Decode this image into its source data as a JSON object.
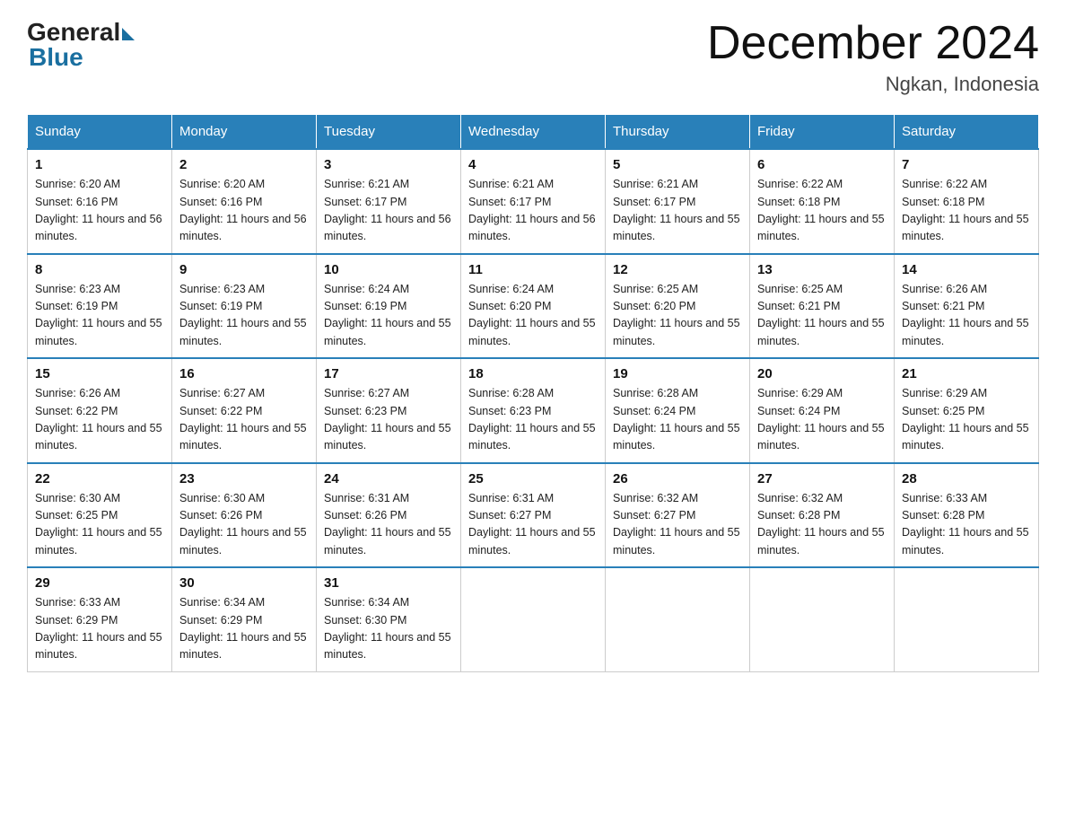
{
  "header": {
    "logo_general": "General",
    "logo_blue": "Blue",
    "title": "December 2024",
    "location": "Ngkan, Indonesia"
  },
  "days_of_week": [
    "Sunday",
    "Monday",
    "Tuesday",
    "Wednesday",
    "Thursday",
    "Friday",
    "Saturday"
  ],
  "weeks": [
    [
      {
        "day": 1,
        "sunrise": "6:20 AM",
        "sunset": "6:16 PM",
        "daylight": "11 hours and 56 minutes."
      },
      {
        "day": 2,
        "sunrise": "6:20 AM",
        "sunset": "6:16 PM",
        "daylight": "11 hours and 56 minutes."
      },
      {
        "day": 3,
        "sunrise": "6:21 AM",
        "sunset": "6:17 PM",
        "daylight": "11 hours and 56 minutes."
      },
      {
        "day": 4,
        "sunrise": "6:21 AM",
        "sunset": "6:17 PM",
        "daylight": "11 hours and 56 minutes."
      },
      {
        "day": 5,
        "sunrise": "6:21 AM",
        "sunset": "6:17 PM",
        "daylight": "11 hours and 55 minutes."
      },
      {
        "day": 6,
        "sunrise": "6:22 AM",
        "sunset": "6:18 PM",
        "daylight": "11 hours and 55 minutes."
      },
      {
        "day": 7,
        "sunrise": "6:22 AM",
        "sunset": "6:18 PM",
        "daylight": "11 hours and 55 minutes."
      }
    ],
    [
      {
        "day": 8,
        "sunrise": "6:23 AM",
        "sunset": "6:19 PM",
        "daylight": "11 hours and 55 minutes."
      },
      {
        "day": 9,
        "sunrise": "6:23 AM",
        "sunset": "6:19 PM",
        "daylight": "11 hours and 55 minutes."
      },
      {
        "day": 10,
        "sunrise": "6:24 AM",
        "sunset": "6:19 PM",
        "daylight": "11 hours and 55 minutes."
      },
      {
        "day": 11,
        "sunrise": "6:24 AM",
        "sunset": "6:20 PM",
        "daylight": "11 hours and 55 minutes."
      },
      {
        "day": 12,
        "sunrise": "6:25 AM",
        "sunset": "6:20 PM",
        "daylight": "11 hours and 55 minutes."
      },
      {
        "day": 13,
        "sunrise": "6:25 AM",
        "sunset": "6:21 PM",
        "daylight": "11 hours and 55 minutes."
      },
      {
        "day": 14,
        "sunrise": "6:26 AM",
        "sunset": "6:21 PM",
        "daylight": "11 hours and 55 minutes."
      }
    ],
    [
      {
        "day": 15,
        "sunrise": "6:26 AM",
        "sunset": "6:22 PM",
        "daylight": "11 hours and 55 minutes."
      },
      {
        "day": 16,
        "sunrise": "6:27 AM",
        "sunset": "6:22 PM",
        "daylight": "11 hours and 55 minutes."
      },
      {
        "day": 17,
        "sunrise": "6:27 AM",
        "sunset": "6:23 PM",
        "daylight": "11 hours and 55 minutes."
      },
      {
        "day": 18,
        "sunrise": "6:28 AM",
        "sunset": "6:23 PM",
        "daylight": "11 hours and 55 minutes."
      },
      {
        "day": 19,
        "sunrise": "6:28 AM",
        "sunset": "6:24 PM",
        "daylight": "11 hours and 55 minutes."
      },
      {
        "day": 20,
        "sunrise": "6:29 AM",
        "sunset": "6:24 PM",
        "daylight": "11 hours and 55 minutes."
      },
      {
        "day": 21,
        "sunrise": "6:29 AM",
        "sunset": "6:25 PM",
        "daylight": "11 hours and 55 minutes."
      }
    ],
    [
      {
        "day": 22,
        "sunrise": "6:30 AM",
        "sunset": "6:25 PM",
        "daylight": "11 hours and 55 minutes."
      },
      {
        "day": 23,
        "sunrise": "6:30 AM",
        "sunset": "6:26 PM",
        "daylight": "11 hours and 55 minutes."
      },
      {
        "day": 24,
        "sunrise": "6:31 AM",
        "sunset": "6:26 PM",
        "daylight": "11 hours and 55 minutes."
      },
      {
        "day": 25,
        "sunrise": "6:31 AM",
        "sunset": "6:27 PM",
        "daylight": "11 hours and 55 minutes."
      },
      {
        "day": 26,
        "sunrise": "6:32 AM",
        "sunset": "6:27 PM",
        "daylight": "11 hours and 55 minutes."
      },
      {
        "day": 27,
        "sunrise": "6:32 AM",
        "sunset": "6:28 PM",
        "daylight": "11 hours and 55 minutes."
      },
      {
        "day": 28,
        "sunrise": "6:33 AM",
        "sunset": "6:28 PM",
        "daylight": "11 hours and 55 minutes."
      }
    ],
    [
      {
        "day": 29,
        "sunrise": "6:33 AM",
        "sunset": "6:29 PM",
        "daylight": "11 hours and 55 minutes."
      },
      {
        "day": 30,
        "sunrise": "6:34 AM",
        "sunset": "6:29 PM",
        "daylight": "11 hours and 55 minutes."
      },
      {
        "day": 31,
        "sunrise": "6:34 AM",
        "sunset": "6:30 PM",
        "daylight": "11 hours and 55 minutes."
      },
      null,
      null,
      null,
      null
    ]
  ]
}
